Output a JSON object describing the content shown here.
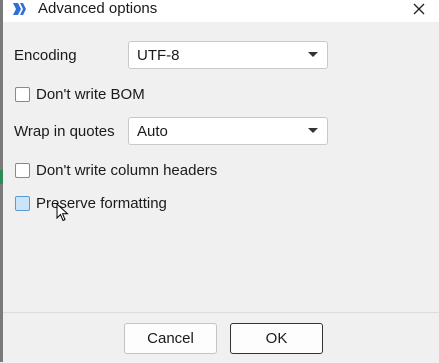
{
  "window": {
    "title": "Advanced options"
  },
  "form": {
    "encoding": {
      "label": "Encoding",
      "value": "UTF-8"
    },
    "dont_write_bom": {
      "label": "Don't write BOM",
      "checked": false
    },
    "wrap_in_quotes": {
      "label": "Wrap in quotes",
      "value": "Auto"
    },
    "dont_write_column_headers": {
      "label": "Don't write column headers",
      "checked": false
    },
    "preserve_formatting": {
      "label": "Preserve formatting",
      "checked": false
    }
  },
  "footer": {
    "cancel_label": "Cancel",
    "ok_label": "OK"
  },
  "icons": {
    "app": "app-logo-icon",
    "close": "close-icon",
    "dropdown": "chevron-down-icon",
    "cursor": "mouse-pointer-icon"
  },
  "colors": {
    "accent_icon": "#2f6fd6",
    "checkbox_hover_fill": "#cce4f7",
    "checkbox_hover_border": "#5b9bd5"
  }
}
